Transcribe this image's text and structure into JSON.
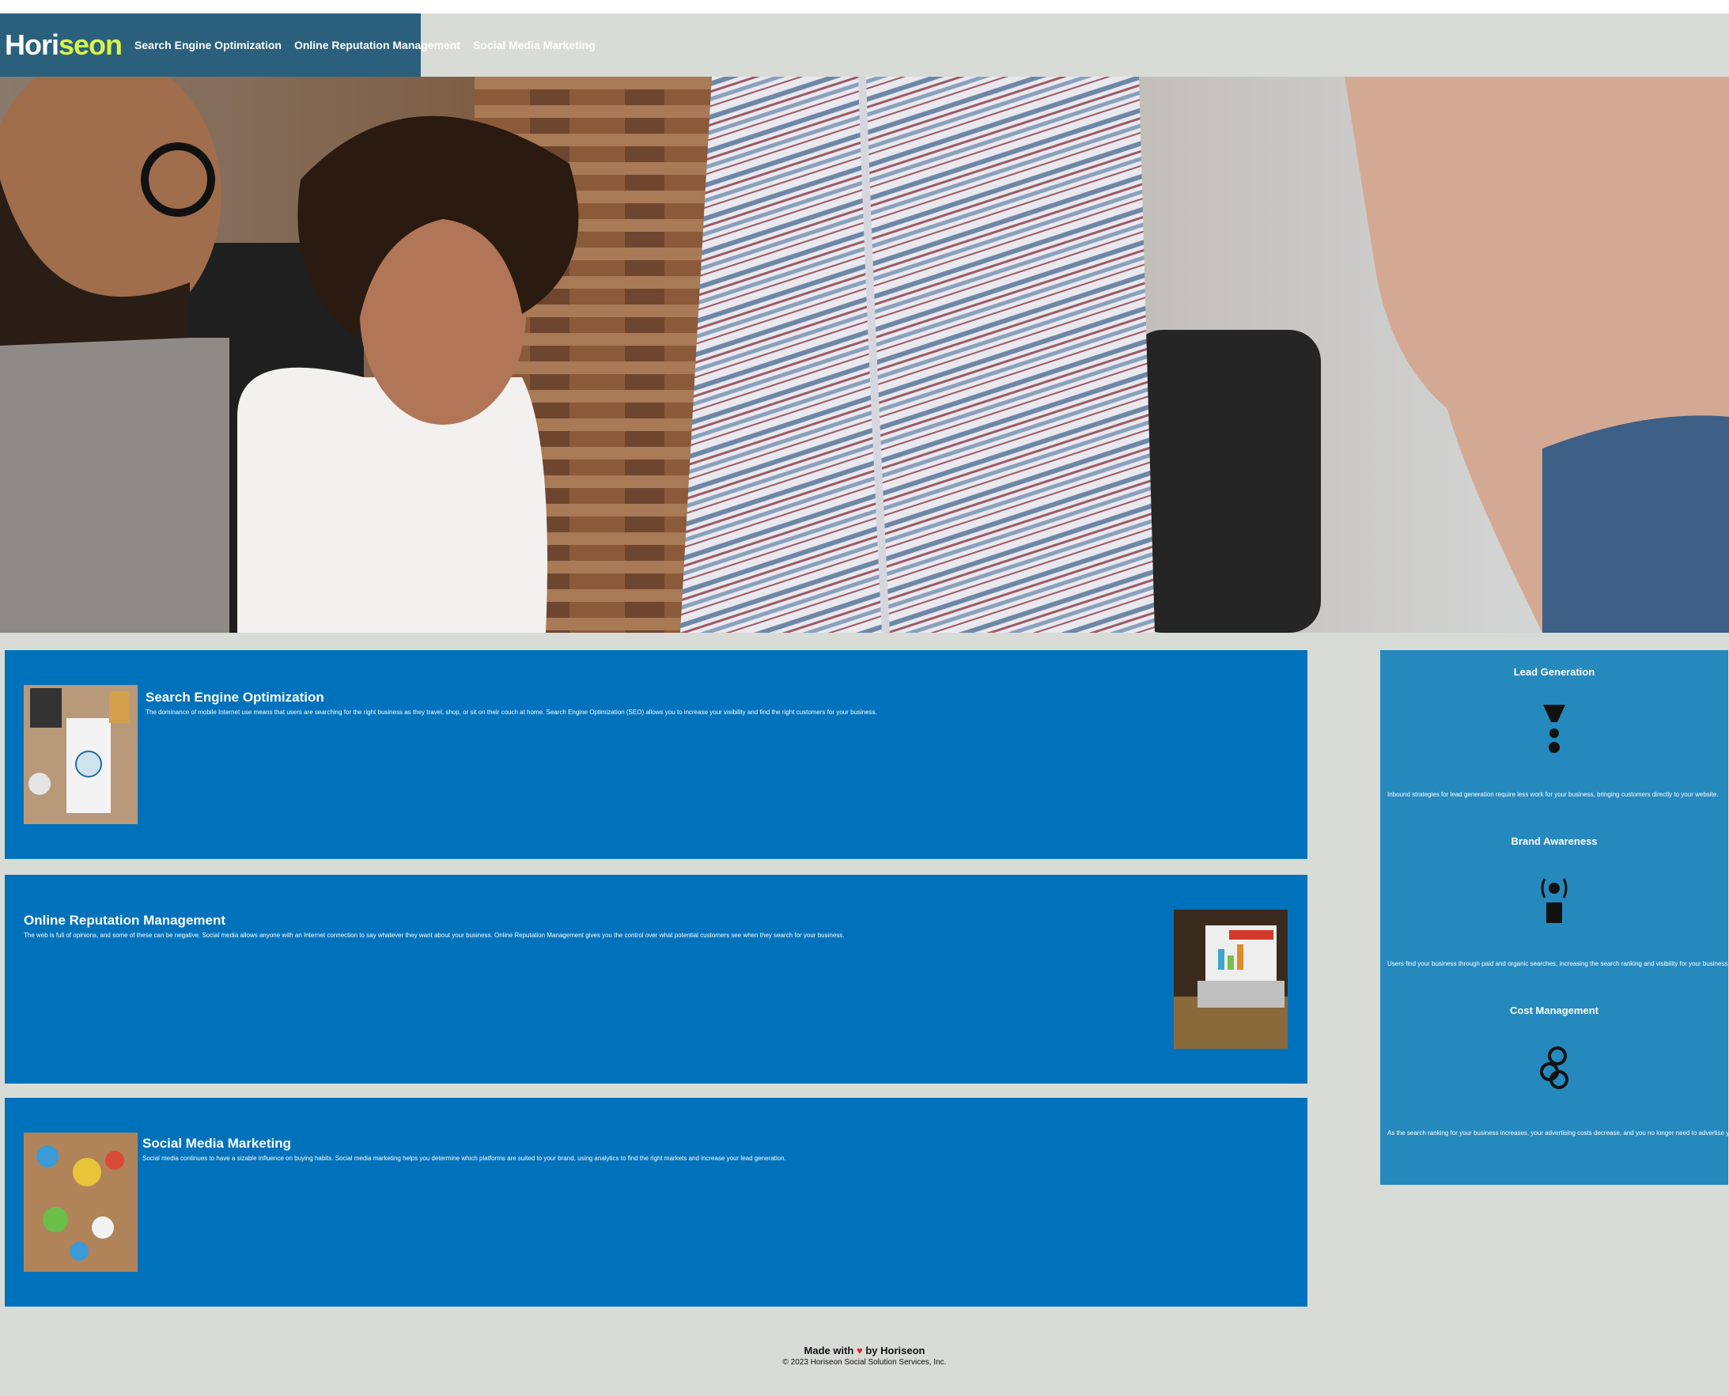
{
  "header": {
    "logo_part1": "Hori",
    "logo_part2": "seon",
    "nav": [
      {
        "label": "Search Engine Optimization"
      },
      {
        "label": "Online Reputation Management"
      },
      {
        "label": "Social Media Marketing"
      }
    ]
  },
  "colors": {
    "header_bg": "#2a607c",
    "logo_accent": "#d9f34a",
    "card_bg": "#0072bb",
    "benefits_bg": "#2589bd",
    "page_bg": "#d9dcd6"
  },
  "cards": [
    {
      "title": "Search Engine Optimization",
      "text": "The dominance of mobile Internet use means that users are searching for the right business as they travel, shop, or sit on their couch at home. Search Engine Optimization (SEO) allows you to increase your visibility and find the right customers for your business.",
      "image": "seo-image"
    },
    {
      "title": "Online Reputation Management",
      "text": "The web is full of opinions, and some of these can be negative. Social media allows anyone with an Internet connection to say whatever they want about your business. Online Reputation Management gives you the control over what potential customers see when they search for your business.",
      "image": "reputation-image"
    },
    {
      "title": "Social Media Marketing",
      "text": "Social media continues to have a sizable influence on buying habits. Social media marketing helps you determine which platforms are suited to your brand, using analytics to find the right markets and increase your lead generation.",
      "image": "social-media-image"
    }
  ],
  "benefits": [
    {
      "title": "Lead Generation",
      "icon": "lead-generation-icon",
      "text": "Inbound strategies for lead generation require less work for your business, bringing customers directly to your website."
    },
    {
      "title": "Brand Awareness",
      "icon": "brand-awareness-icon",
      "text": "Users find your business through paid and organic searches, increasing the search ranking and visibility for your business."
    },
    {
      "title": "Cost Management",
      "icon": "cost-management-icon",
      "text": "As the search ranking for your business increases, your advertising costs decrease, and you no longer need to advertise your cases."
    }
  ],
  "footer": {
    "made_prefix": "Made with",
    "made_suffix": "by Horiseon",
    "copyright": "© 2023 Horiseon Social Solution Services, Inc."
  }
}
